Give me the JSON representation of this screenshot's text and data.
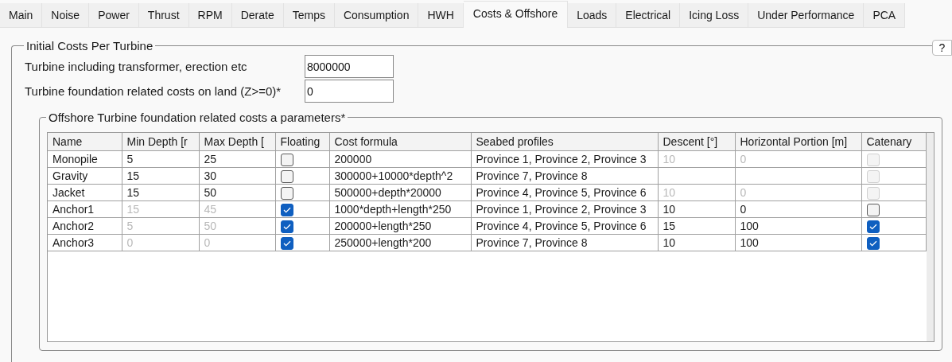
{
  "tabs": [
    {
      "label": "Main",
      "selected": false
    },
    {
      "label": "Noise",
      "selected": false
    },
    {
      "label": "Power",
      "selected": false
    },
    {
      "label": "Thrust",
      "selected": false
    },
    {
      "label": "RPM",
      "selected": false
    },
    {
      "label": "Derate",
      "selected": false
    },
    {
      "label": "Temps",
      "selected": false
    },
    {
      "label": "Consumption",
      "selected": false
    },
    {
      "label": "HWH",
      "selected": false
    },
    {
      "label": "Costs & Offshore",
      "selected": true
    },
    {
      "label": "Loads",
      "selected": false
    },
    {
      "label": "Electrical",
      "selected": false
    },
    {
      "label": "Icing Loss",
      "selected": false
    },
    {
      "label": "Under Performance",
      "selected": false
    },
    {
      "label": "PCA",
      "selected": false
    }
  ],
  "help_button": "?",
  "initial_costs": {
    "title": "Initial Costs Per Turbine",
    "fields": [
      {
        "label": "Turbine including transformer, erection etc",
        "value": "8000000"
      },
      {
        "label": "Turbine foundation related costs on land (Z>=0)*",
        "value": "0"
      }
    ]
  },
  "offshore": {
    "title": "Offshore Turbine foundation related costs a parameters*",
    "table": {
      "columns": [
        {
          "label": "Name",
          "kind": "text"
        },
        {
          "label": "Min Depth [r",
          "kind": "text"
        },
        {
          "label": "Max Depth [",
          "kind": "text"
        },
        {
          "label": "Floating",
          "kind": "check"
        },
        {
          "label": "Cost formula",
          "kind": "text"
        },
        {
          "label": "Seabed profiles",
          "kind": "text"
        },
        {
          "label": "Descent [°]",
          "kind": "text"
        },
        {
          "label": "Horizontal Portion [m]",
          "kind": "text"
        },
        {
          "label": "Catenary",
          "kind": "check"
        }
      ],
      "rows": [
        {
          "cells": [
            {
              "text": "Monopile",
              "disabled": false
            },
            {
              "text": "5",
              "disabled": false
            },
            {
              "text": "25",
              "disabled": false
            },
            {
              "checked": false,
              "disabled": false
            },
            {
              "text": "200000",
              "disabled": false
            },
            {
              "text": "Province 1, Province 2, Province 3",
              "disabled": false
            },
            {
              "text": "10",
              "disabled": true
            },
            {
              "text": "0",
              "disabled": true
            },
            {
              "checked": false,
              "disabled": true
            }
          ]
        },
        {
          "cells": [
            {
              "text": "Gravity",
              "disabled": false
            },
            {
              "text": "15",
              "disabled": false
            },
            {
              "text": "30",
              "disabled": false
            },
            {
              "checked": false,
              "disabled": false
            },
            {
              "text": "300000+10000*depth^2",
              "disabled": false
            },
            {
              "text": "Province 7, Province 8",
              "disabled": false
            },
            {},
            {},
            {
              "checked": false,
              "disabled": true
            }
          ]
        },
        {
          "cells": [
            {
              "text": "Jacket",
              "disabled": false
            },
            {
              "text": "15",
              "disabled": false
            },
            {
              "text": "50",
              "disabled": false
            },
            {
              "checked": false,
              "disabled": false
            },
            {
              "text": "500000+depth*20000",
              "disabled": false
            },
            {
              "text": "Province 4, Province 5, Province 6",
              "disabled": false
            },
            {
              "text": "10",
              "disabled": true
            },
            {
              "text": "0",
              "disabled": true
            },
            {
              "checked": false,
              "disabled": true
            }
          ]
        },
        {
          "cells": [
            {
              "text": "Anchor1",
              "disabled": false
            },
            {
              "text": "15",
              "disabled": true
            },
            {
              "text": "45",
              "disabled": true
            },
            {
              "checked": true,
              "disabled": false
            },
            {
              "text": "1000*depth+length*250",
              "disabled": false
            },
            {
              "text": "Province 1, Province 2, Province 3",
              "disabled": false
            },
            {
              "text": "10",
              "disabled": false
            },
            {
              "text": "0",
              "disabled": false
            },
            {
              "checked": false,
              "disabled": false
            }
          ]
        },
        {
          "cells": [
            {
              "text": "Anchor2",
              "disabled": false
            },
            {
              "text": "5",
              "disabled": true
            },
            {
              "text": "50",
              "disabled": true
            },
            {
              "checked": true,
              "disabled": false
            },
            {
              "text": "200000+length*250",
              "disabled": false
            },
            {
              "text": "Province 4, Province 5, Province 6",
              "disabled": false
            },
            {
              "text": "15",
              "disabled": false
            },
            {
              "text": "100",
              "disabled": false
            },
            {
              "checked": true,
              "disabled": false
            }
          ]
        },
        {
          "cells": [
            {
              "text": "Anchor3",
              "disabled": false
            },
            {
              "text": "0",
              "disabled": true
            },
            {
              "text": "0",
              "disabled": true
            },
            {
              "checked": true,
              "disabled": false
            },
            {
              "text": "250000+length*200",
              "disabled": false
            },
            {
              "text": "Province 7, Province 8",
              "disabled": false
            },
            {
              "text": "10",
              "disabled": false
            },
            {
              "text": "100",
              "disabled": false
            },
            {
              "checked": true,
              "disabled": false
            }
          ]
        }
      ]
    }
  }
}
